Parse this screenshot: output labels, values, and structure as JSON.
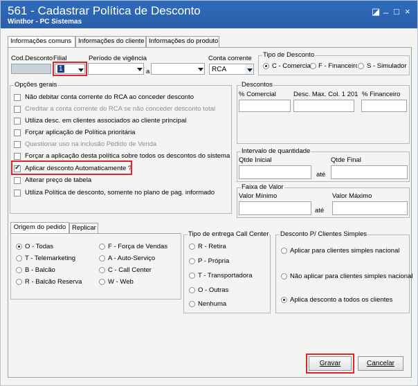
{
  "window": {
    "title": "561 - Cadastrar Política de Desconto",
    "subtitle": "Winthor - PC Sistemas",
    "buttons": [
      "◪",
      "_",
      "□",
      "×"
    ]
  },
  "tabs": [
    "Informações comuns",
    "Informações do cliente",
    "Informações do produto"
  ],
  "header": {
    "cod_label": "Cod.Desconto",
    "filial_label": "Filial",
    "filial_value": "1",
    "vigencia_label": "Período de vigência",
    "a_label": "a",
    "conta_label": "Conta corrente",
    "conta_value": "RCA",
    "tipo_label": "Tipo de Desconto",
    "tipo_options": [
      "C - Comercial",
      "F - Financeiro",
      "S - Simulador"
    ]
  },
  "opcoes": {
    "legend": "Opções gerais",
    "items": [
      {
        "label": "Não debitar conta corrente do RCA ao conceder desconto",
        "checked": false,
        "disabled": false
      },
      {
        "label": "Creditar a conta corrente do RCA se não conceder desconto total",
        "checked": false,
        "disabled": true
      },
      {
        "label": "Utiliza desc. em clientes associados ao cliente principal",
        "checked": false,
        "disabled": false
      },
      {
        "label": "Forçar aplicação de Política prioritária",
        "checked": false,
        "disabled": false
      },
      {
        "label": "Questionar uso na inclusão Pedido de Venda",
        "checked": false,
        "disabled": true
      },
      {
        "label": "Forçar a aplicação desta política sobre todos os descontos do sistema",
        "checked": false,
        "disabled": false
      },
      {
        "label": "Aplicar desconto Automaticamente ?",
        "checked": true,
        "disabled": false
      },
      {
        "label": "Alterar preço de tabela",
        "checked": false,
        "disabled": false
      },
      {
        "label": "Utiliza Política de desconto, somente no plano de pag. informado",
        "checked": false,
        "disabled": false
      }
    ]
  },
  "descontos": {
    "legend": "Descontos",
    "c1": "% Comercial",
    "c2": "Desc. Max. Col. 1 201",
    "c3": "% Financeiro"
  },
  "intervalo": {
    "legend": "Intervalo de quantidade",
    "l1": "Qtde Inicial",
    "l2": "Qtde Final",
    "ate": "até"
  },
  "faixa": {
    "legend": "Faixa de Valor",
    "l1": "Valor Mínimo",
    "l2": "Valor Máximo",
    "ate": "até"
  },
  "subtabs": [
    "Origem do pedido",
    "Replicar"
  ],
  "origem": {
    "col1": [
      "O - Todas",
      "T - Telemarketing",
      "B - Balcão",
      "R - Balcão Reserva"
    ],
    "col2": [
      "F - Força de Vendas",
      "A - Auto-Serviço",
      "C - Call Center",
      "W - Web"
    ]
  },
  "entrega": {
    "legend": "Tipo de entrega Call Center",
    "items": [
      "R - Retira",
      "P - Própria",
      "T - Transportadora",
      "O - Outras",
      "Nenhuma"
    ]
  },
  "simples": {
    "legend": "Desconto P/ Clientes Simples",
    "items": [
      "Aplicar para clientes simples nacional",
      "Não aplicar para clientes simples nacional",
      "Aplica desconto a todos os clientes"
    ]
  },
  "footer": {
    "gravar": "Gravar",
    "cancelar": "Cancelar"
  }
}
